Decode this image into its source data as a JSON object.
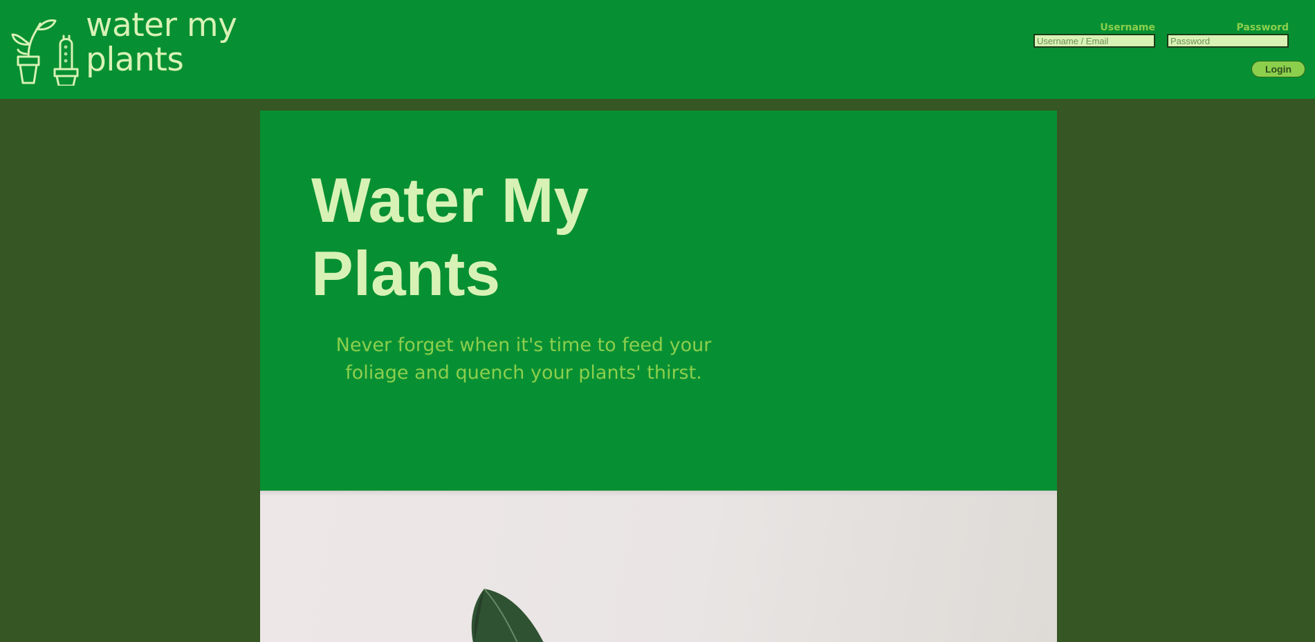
{
  "header": {
    "logo_line1": "water my",
    "logo_line2": "plants",
    "logo_icon": "potted-plants-icon"
  },
  "login": {
    "username_label": "Username",
    "username_placeholder": "Username / Email",
    "username_value": "",
    "password_label": "Password",
    "password_placeholder": "Password",
    "password_value": "",
    "login_button": "Login"
  },
  "hero": {
    "title": "Water My Plants",
    "subtitle": "Never forget when it's time to feed your foliage and quench your plants' thirst."
  },
  "colors": {
    "header_bg": "#079033",
    "page_bg": "#365623",
    "light_text": "#d8f2b5",
    "accent": "#8ccf4d"
  }
}
